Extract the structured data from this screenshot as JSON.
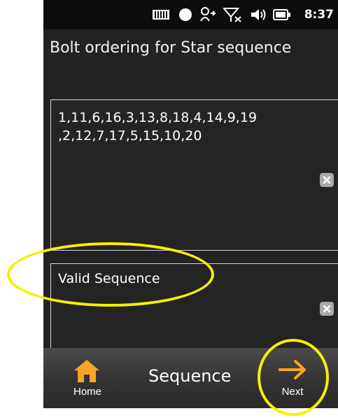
{
  "status_bar": {
    "time": "8:37",
    "icons": [
      "signal-bars-icon",
      "record-dot-icon",
      "sync-person-icon",
      "no-signal-icon",
      "volume-icon",
      "battery-icon"
    ]
  },
  "screen": {
    "title": "Bolt ordering for Star sequence"
  },
  "sequence_panel": {
    "value": "1,11,6,16,3,13,8,18,4,14,9,19 ,2,12,7,17,5,15,10,20"
  },
  "status_panel": {
    "value": "Valid Sequence"
  },
  "nav": {
    "home_label": "Home",
    "title": "Sequence",
    "next_label": "Next"
  },
  "colors": {
    "background": "#222222",
    "accent_orange": "#f5a623",
    "annotation_yellow": "#f5f000"
  }
}
